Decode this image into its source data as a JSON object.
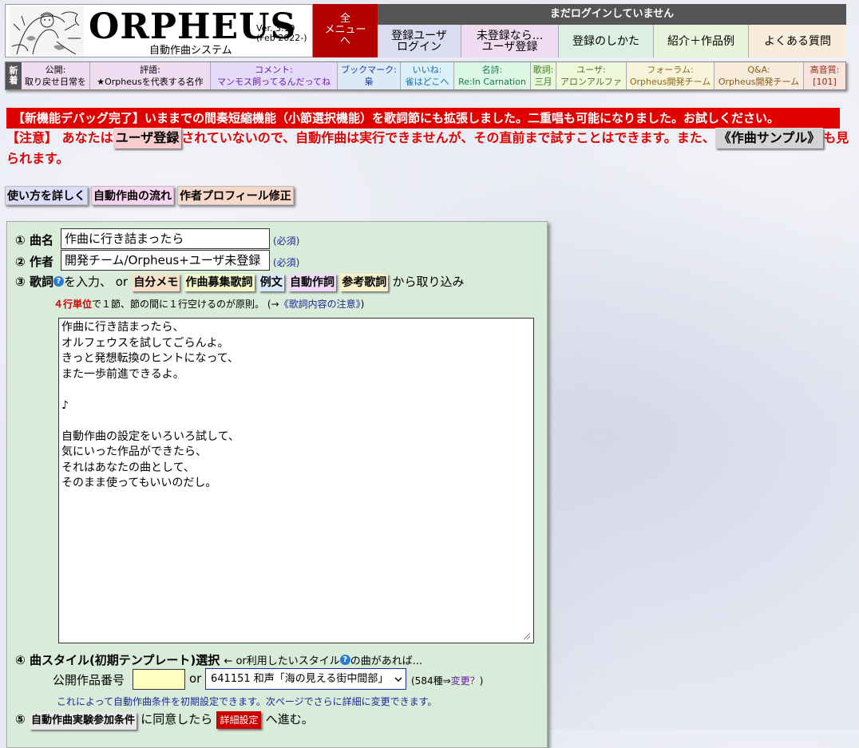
{
  "header": {
    "logo_title": "ORPHEUS",
    "logo_sub": "自動作曲システム",
    "version": "Ver. 3.19",
    "version_date": "(Feb 2022-)",
    "all_menu": "全\nメニュー\nへ",
    "login_status": "まだログインしていません",
    "buttons": [
      {
        "label": "登録ユーザ\nログイン",
        "color": "#dcdcf0"
      },
      {
        "label": "未登録なら...\nユーザ登録",
        "color": "#f0dcf0"
      },
      {
        "label": "登録のしかた",
        "color": "#dcf0e4"
      },
      {
        "label": "紹介＋作品例",
        "color": "#e8f4dc"
      },
      {
        "label": "よくある質問",
        "color": "#f8ecdc"
      }
    ]
  },
  "nav": {
    "new_label": "新着",
    "items": [
      {
        "head": "公開:",
        "text": "取り戻せ日常を",
        "color": "#f0dcf0"
      },
      {
        "head": "評語:",
        "text": "★Orpheusを代表する名作",
        "color": "#f0dcf0"
      },
      {
        "head": "コメント:",
        "text": "マンモス飼ってるんだってね",
        "color": "#e4dcf8"
      },
      {
        "head": "ブックマーク:",
        "text": "梟",
        "color": "#dceaf8"
      },
      {
        "head": "いいね:",
        "text": "雀はどこへ",
        "color": "#dcf0f8"
      },
      {
        "head": "名詩:",
        "text": "Re:In Carnation",
        "color": "#dcf8e4"
      },
      {
        "head": "歌詞:",
        "text": "三月",
        "color": "#e8f8dc"
      },
      {
        "head": "ユーザ:",
        "text": "アロンアルファ",
        "color": "#f0f8dc"
      },
      {
        "head": "フォーラム:",
        "text": "Orpheus開発チーム",
        "color": "#f8f4dc"
      },
      {
        "head": "Q&A:",
        "text": "Orpheus開発チーム",
        "color": "#f8ecdc"
      },
      {
        "head": "高音質:",
        "text": "[101]",
        "color": "#f8e4dc"
      }
    ]
  },
  "announce": "【新機能デバッグ完了】いままでの間奏短縮機能（小節選択機能）を歌詞節にも拡張しました。二重唱も可能になりました。お試しください。",
  "notice": {
    "prefix": "【注意】 あなたは",
    "chip": "ユーザ登録",
    "middle": "されていないので、自動作曲は実行できませんが、その直前まで試すことはできます。また、",
    "sample": "《作曲サンプル》",
    "suffix": "も見られます。"
  },
  "help_buttons": [
    {
      "label": "使い方を詳しく",
      "color": "#dcdcf8"
    },
    {
      "label": "自動作曲の流れ",
      "color": "#f8d4f0"
    },
    {
      "label": "作者プロフィール修正",
      "color": "#f8d8c8"
    }
  ],
  "form": {
    "title_num": "①",
    "title_label": "曲名",
    "title_value": "作曲に行き詰まったら",
    "required": "(必須)",
    "author_num": "②",
    "author_label": "作者",
    "author_value": "開発チーム/Orpheus+ユーザ未登録",
    "lyrics_num": "③",
    "lyrics_label": "歌詞",
    "lyrics_input_text": "を入力、 or",
    "lyrics_sources": [
      {
        "label": "自分メモ",
        "color": "#f8e0c8"
      },
      {
        "label": "作曲募集歌詞",
        "color": "#f0f8c8"
      },
      {
        "label": "例文",
        "color": "#d8e8f8"
      },
      {
        "label": "自動作詞",
        "color": "#f0d8f8"
      },
      {
        "label": "参考歌詞",
        "color": "#f8f0c8"
      }
    ],
    "lyrics_source_suffix": "から取り込み",
    "lyrics_hint_red": "４行単位",
    "lyrics_hint": "で１節、節の間に１行空けるのが原則。 (→",
    "lyrics_hint_link": "《歌詞内容の注意》",
    "lyrics_hint_end": ")",
    "lyrics_text": "作曲に行き詰まったら、\nオルフェウスを試してごらんよ。\nきっと発想転換のヒントになって、\nまた一歩前進できるよ。\n\n♪\n\n自動作曲の設定をいろいろ試して、\n気にいった作品ができたら、\nそれはあなたの曲として、\nそのまま使ってもいいのだし。",
    "style_num": "④",
    "style_label": "曲スタイル(初期テンプレート)選択",
    "style_text": "← or利用したいスタイル",
    "style_text2": "の曲があれば...",
    "public_no_label": "公開作品番号",
    "or": "or",
    "style_select": "641151 和声「海の見える街中間部」",
    "style_count": "(584種⇒",
    "style_change": "変更？",
    "style_count_end": ")",
    "style_note": "これによって自動作曲条件を初期設定できます。次ページでさらに詳細に変更できます。",
    "agree_num": "⑤",
    "agree_chip": "自動作曲実験参加条件",
    "agree_text": "に同意したら",
    "detail_btn": "詳細設定",
    "agree_end": "へ進む。"
  }
}
